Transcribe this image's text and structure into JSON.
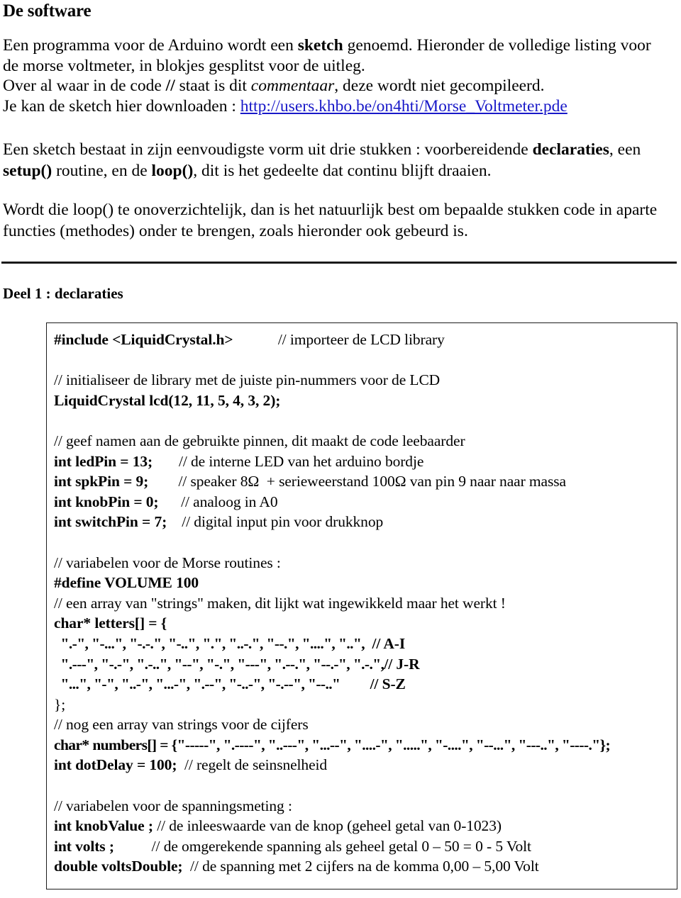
{
  "document": {
    "title": "De software",
    "intro": {
      "line1_a": "Een programma voor de Arduino wordt een ",
      "line1_bold": "sketch",
      "line1_b": " genoemd. Hieronder de volledige listing voor de morse voltmeter, in blokjes gesplitst voor de uitleg.",
      "line2_a": "Over al waar in de code ",
      "line2_bold": "//",
      "line2_b": " staat is dit ",
      "line2_italic": "commentaar",
      "line2_c": ", deze wordt niet gecompileerd.",
      "line3_a": "Je kan de sketch hier downloaden : ",
      "line3_link": "http://users.khbo.be/on4hti/Morse_Voltmeter.pde"
    },
    "paragraph2": {
      "a": "Een sketch bestaat in zijn eenvoudigste vorm uit drie stukken : voorbereidende ",
      "bold1": "declaraties",
      "b": ", een ",
      "bold2": "setup()",
      "c": " routine, en de ",
      "bold3": "loop()",
      "d": ", dit is het gedeelte dat continu blijft draaien."
    },
    "paragraph3": "Wordt die loop() te onoverzichtelijk, dan is het natuurlijk best om bepaalde stukken code in aparte functies (methodes) onder te brengen, zoals hieronder ook gebeurd is.",
    "section_heading": "Deel 1 : declaraties"
  },
  "code": {
    "l01_code": "#include <LiquidCrystal.h>",
    "l01_pad": "            ",
    "l01_comment": "// importeer de LCD library",
    "l02_comment": "// initialiseer de library met de juiste pin-nummers voor de LCD",
    "l03_code": "LiquidCrystal lcd(12, 11, 5, 4, 3, 2);",
    "l04_comment": "// geef namen aan de gebruikte pinnen, dit maakt de code leebaarder",
    "l05_code": "int ledPin = 13;",
    "l05_pad": "       ",
    "l05_comment": "// de interne LED van het arduino bordje",
    "l06_code": "int spkPin = 9;",
    "l06_pad": "        ",
    "l06_comment": "// speaker 8Ω  + serieweerstand 100Ω van pin 9 naar naar massa",
    "l07_code": "int knobPin = 0;",
    "l07_pad": "      ",
    "l07_comment": "// analoog in A0",
    "l08_code": "int switchPin = 7;",
    "l08_pad": "    ",
    "l08_comment": "// digital input pin voor drukknop",
    "l09_comment": "// variabelen voor de Morse routines :",
    "l10_code": "#define VOLUME 100",
    "l11_comment": "// een array van \"strings\" maken, dit lijkt wat ingewikkeld maar het werkt !",
    "l12_code": "char* letters[] = {",
    "l13_morse": "  \".-\", \"-...\", \"-.-.\", \"-..\", \".\", \"..-.\", \"--.\", \"....\", \"..\",",
    "l13_pad": "  ",
    "l13_comment": "// A-I",
    "l14_morse": "  \".---\", \"-.-\", \".-..\", \"--\", \"-.\", \"---\", \".--.\", \"--.-\", \".-.\",",
    "l14_comment": "// J-R",
    "l15_morse": "  \"...\", \"-\", \"..-\", \"...-\", \".--\", \"-..-\", \"-.--\", \"--..\"",
    "l15_pad": "        ",
    "l15_comment": "// S-Z",
    "l16_code": "};",
    "l17_comment": "// nog een array van strings voor de cijfers",
    "l18_code": "char* numbers[] = {\"-----\", \".----\", \"..---\", \"...--\", \"....-\", \".....\", \"-....\", \"--...\", \"---..\", \"----.\"};",
    "l19_code": "int dotDelay = 100;",
    "l19_pad": "  ",
    "l19_comment": "// regelt de seinsnelheid",
    "l20_comment": "// variabelen voor de spanningsmeting :",
    "l21_code": "int knobValue ;",
    "l21_pad": " ",
    "l21_comment": "// de inleeswaarde van de knop (geheel getal van 0-1023)",
    "l22_code": "int volts ;",
    "l22_pad": "          ",
    "l22_comment": "// de omgerekende spanning als geheel getal 0 – 50 = 0 - 5 Volt",
    "l23_code": "double voltsDouble;",
    "l23_pad": "  ",
    "l23_comment": "// de spanning met 2 cijfers na de komma 0,00 – 5,00 Volt"
  },
  "colors": {
    "link": "#1818c8",
    "text": "#000000",
    "border": "#1c1c1c"
  }
}
